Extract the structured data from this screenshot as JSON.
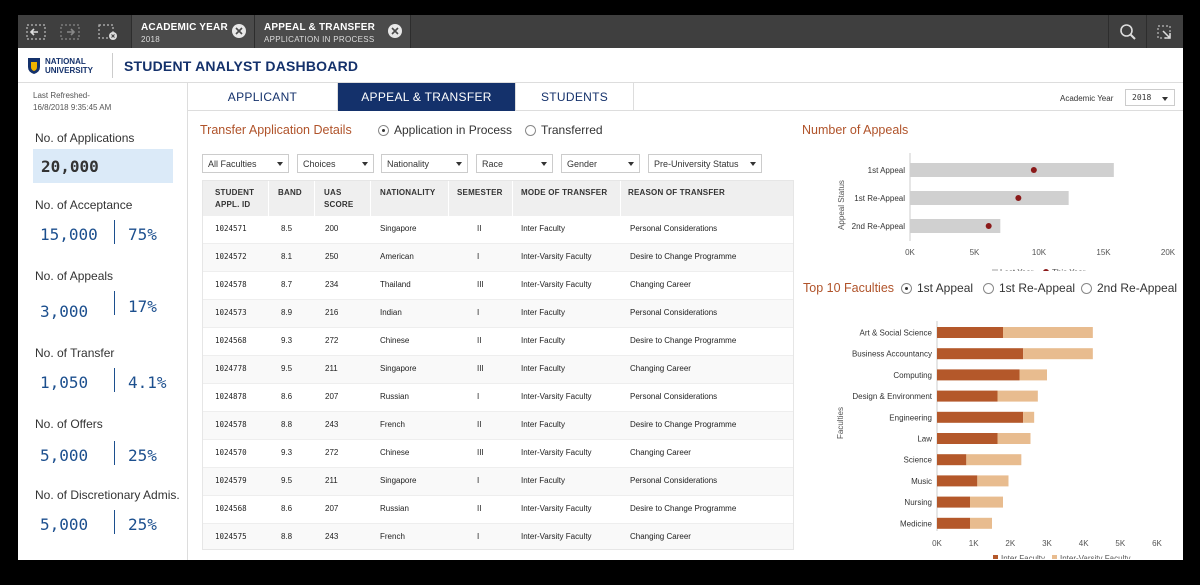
{
  "selection_bar": {
    "chips": [
      {
        "title": "ACADEMIC YEAR",
        "value": "2018"
      },
      {
        "title": "APPEAL & TRANSFER",
        "value": "APPLICATION IN PROCESS"
      }
    ]
  },
  "header": {
    "logo_line1": "NATIONAL",
    "logo_line2": "UNIVERSITY",
    "title": "STUDENT ANALYST  DASHBOARD"
  },
  "left": {
    "refresh_label": "Last Refreshed-",
    "refresh_time": "16/8/2018 9:35:45 AM",
    "applications_label": "No. of Applications",
    "applications_value": "20,000",
    "kpis": [
      {
        "label": "No. of Acceptance",
        "value": "15,000",
        "pct": "75%"
      },
      {
        "label": "No. of Appeals",
        "value": "3,000",
        "pct": "17%"
      },
      {
        "label": "No. of Transfer",
        "value": "1,050",
        "pct": "4.1%"
      },
      {
        "label": "No. of Offers",
        "value": "5,000",
        "pct": "25%"
      },
      {
        "label": "No. of Discretionary Admis.",
        "value": "5,000",
        "pct": "25%"
      }
    ]
  },
  "tabs": [
    {
      "label": "APPLICANT"
    },
    {
      "label": "APPEAL & TRANSFER",
      "active": true
    },
    {
      "label": "STUDENTS"
    }
  ],
  "academic_year": {
    "label": "Academic Year",
    "value": "2018"
  },
  "transfer": {
    "title": "Transfer Application Details",
    "radio_in_process": "Application in Process",
    "radio_transferred": "Transferred",
    "filters": [
      "All Faculties",
      "Choices",
      "Nationality",
      "Race",
      "Gender",
      "Pre-University Status"
    ],
    "columns": [
      {
        "l1": "STUDENT",
        "l2": "APPL. ID"
      },
      {
        "l1": "BAND",
        "l2": ""
      },
      {
        "l1": "UAS",
        "l2": "SCORE"
      },
      {
        "l1": "NATIONALITY",
        "l2": ""
      },
      {
        "l1": "SEMESTER",
        "l2": ""
      },
      {
        "l1": "MODE OF TRANSFER",
        "l2": ""
      },
      {
        "l1": "REASON OF TRANSFER",
        "l2": ""
      }
    ],
    "rows": [
      [
        "1024571",
        "8.5",
        "200",
        "Singapore",
        "II",
        "Inter Faculty",
        "Personal Considerations"
      ],
      [
        "1024572",
        "8.1",
        "250",
        "American",
        "I",
        "Inter-Varsity Faculty",
        "Desire to Change Programme"
      ],
      [
        "1024578",
        "8.7",
        "234",
        "Thailand",
        "III",
        "Inter-Varsity Faculty",
        "Changing Career"
      ],
      [
        "1024573",
        "8.9",
        "216",
        "Indian",
        "I",
        "Inter Faculty",
        "Personal Considerations"
      ],
      [
        "1024568",
        "9.3",
        "272",
        "Chinese",
        "II",
        "Inter Faculty",
        "Desire to Change Programme"
      ],
      [
        "1024778",
        "9.5",
        "211",
        "Singapore",
        "III",
        "Inter Faculty",
        "Changing Career"
      ],
      [
        "1024878",
        "8.6",
        "207",
        "Russian",
        "I",
        "Inter-Varsity Faculty",
        "Personal Considerations"
      ],
      [
        "1024578",
        "8.8",
        "243",
        "French",
        "II",
        "Inter Faculty",
        "Desire to Change Programme"
      ],
      [
        "1024570",
        "9.3",
        "272",
        "Chinese",
        "III",
        "Inter-Varsity Faculty",
        "Changing Career"
      ],
      [
        "1024579",
        "9.5",
        "211",
        "Singapore",
        "I",
        "Inter Faculty",
        "Personal Considerations"
      ],
      [
        "1024568",
        "8.6",
        "207",
        "Russian",
        "II",
        "Inter-Varsity Faculty",
        "Desire to Change Programme"
      ],
      [
        "1024575",
        "8.8",
        "243",
        "French",
        "I",
        "Inter-Varsity Faculty",
        "Changing Career"
      ]
    ]
  },
  "appeals": {
    "title": "Number of Appeals"
  },
  "faculties": {
    "title": "Top 10 Faculties",
    "radio_1": "1st Appeal",
    "radio_2": "1st Re-Appeal",
    "radio_3": "2nd Re-Appeal"
  },
  "colors": {
    "brand": "#14316b",
    "accent": "#b0532a",
    "inter": "#b4582a",
    "inter_varsity": "#e8bc8f",
    "gray_bar": "#d0d0d0",
    "dot": "#8b1a1a"
  },
  "chart_data": [
    {
      "type": "bar",
      "orientation": "horizontal",
      "title": "Number of Appeals",
      "ylabel": "Appeal Status",
      "categories": [
        "1st Appeal",
        "1st Re-Appeal",
        "2nd Re-Appeal"
      ],
      "series": [
        {
          "name": "Last Year",
          "values": [
            15800,
            12300,
            7000
          ]
        },
        {
          "name": "This Year",
          "values": [
            9600,
            8400,
            6100
          ]
        }
      ],
      "xlim": [
        0,
        20000
      ],
      "xticks": [
        "0K",
        "5K",
        "10K",
        "15K",
        "20K"
      ],
      "legend": "bottom"
    },
    {
      "type": "bar",
      "orientation": "horizontal",
      "stacked": true,
      "title": "Top 10 Faculties",
      "ylabel": "Faculties",
      "categories": [
        "Art & Social Science",
        "Business Accountancy",
        "Computing",
        "Design & Environment",
        "Engineering",
        "Law",
        "Science",
        "Music",
        "Nursing",
        "Medicine"
      ],
      "series": [
        {
          "name": "Inter Faculty",
          "values": [
            1800,
            2350,
            2250,
            1650,
            2350,
            1650,
            800,
            1100,
            900,
            900
          ]
        },
        {
          "name": "Inter-Varsity Faculty",
          "values": [
            2450,
            1900,
            750,
            1100,
            300,
            900,
            1500,
            850,
            900,
            600
          ]
        }
      ],
      "xlim": [
        0,
        6000
      ],
      "xticks": [
        "0K",
        "1K",
        "2K",
        "3K",
        "4K",
        "5K",
        "6K"
      ],
      "legend": "bottom"
    }
  ]
}
